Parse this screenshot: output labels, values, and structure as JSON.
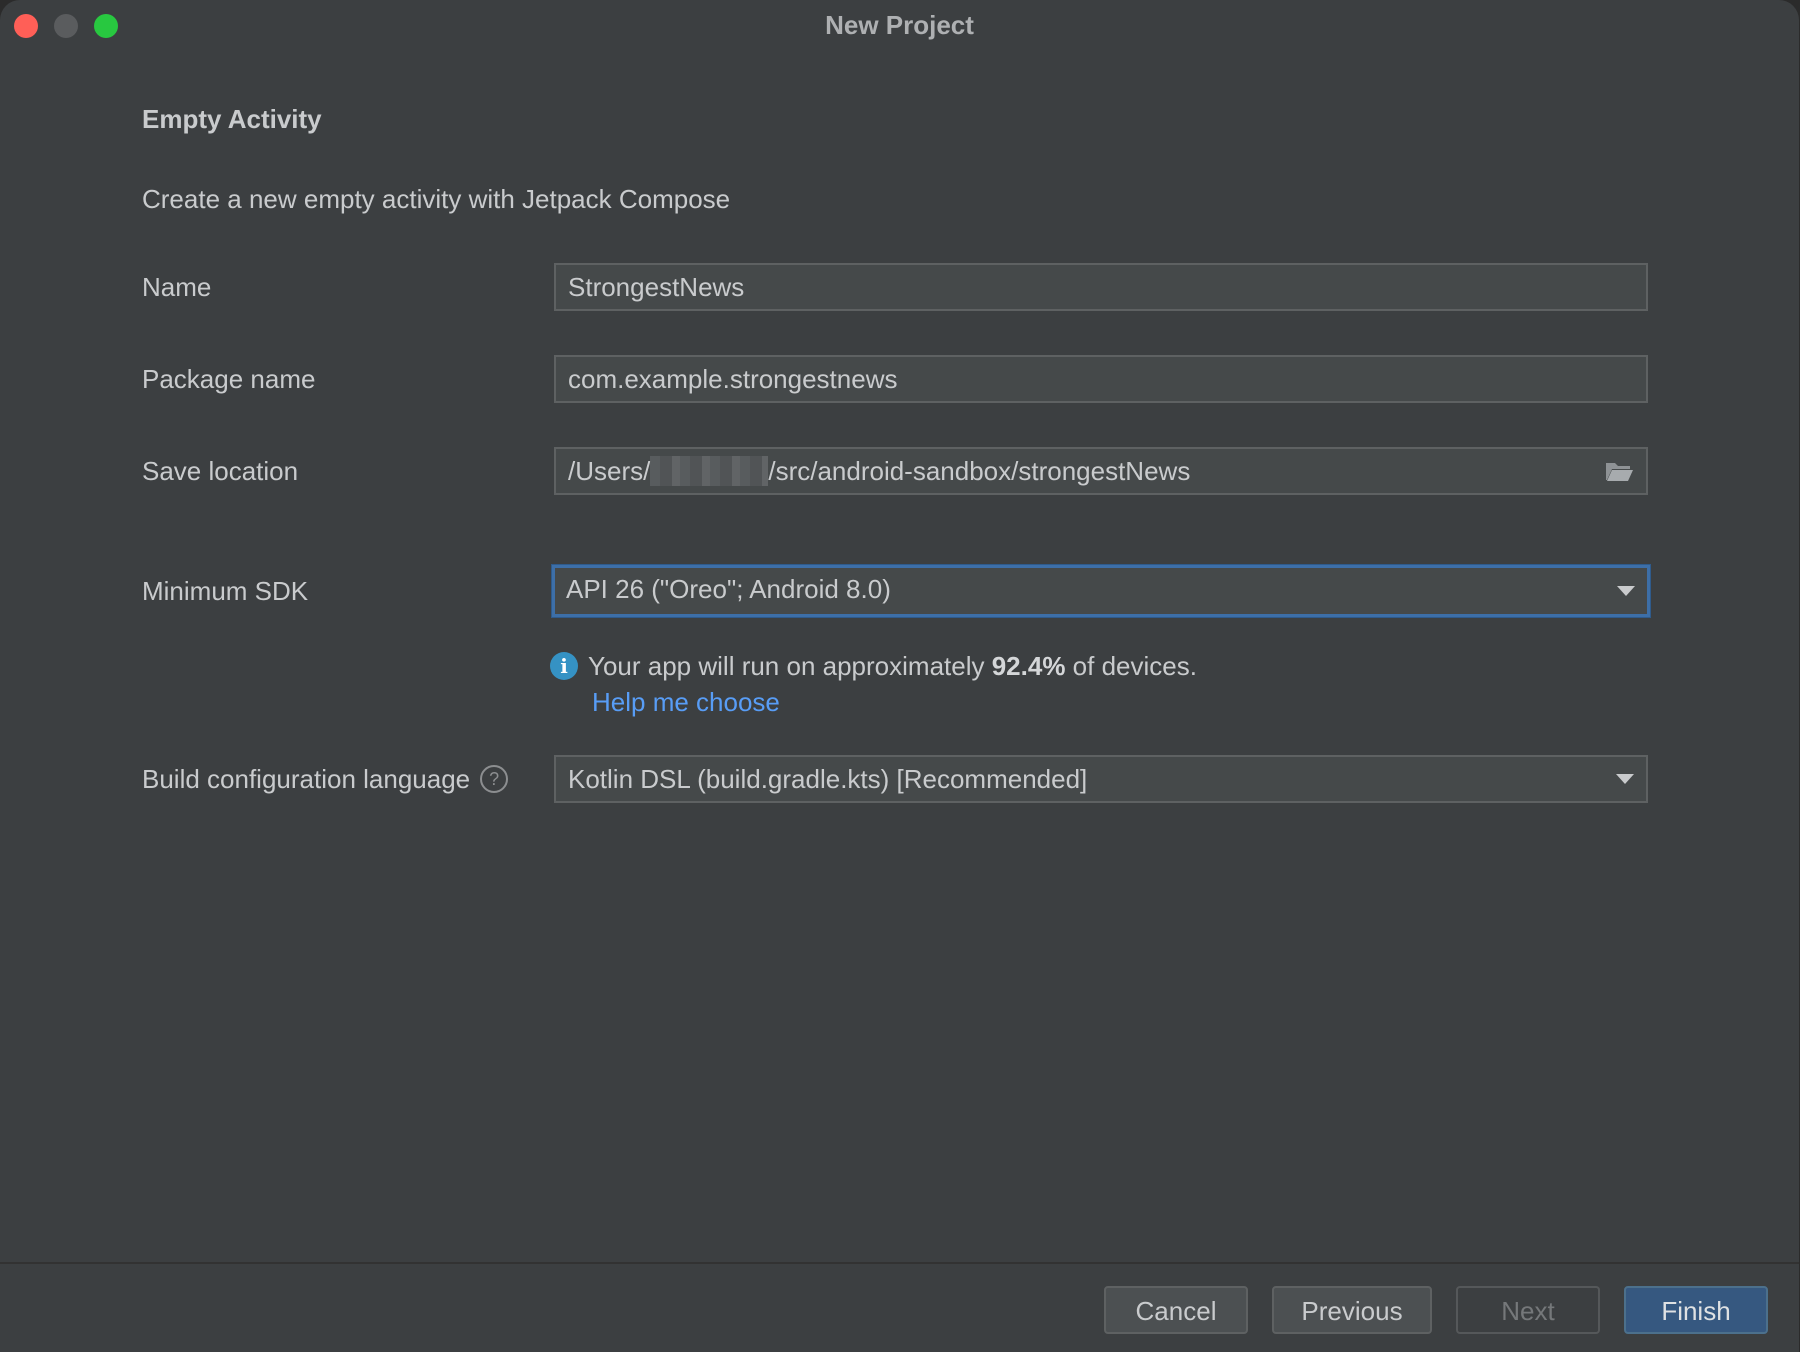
{
  "window": {
    "title": "New Project"
  },
  "template": {
    "heading": "Empty Activity",
    "description": "Create a new empty activity with Jetpack Compose"
  },
  "form": {
    "name": {
      "label": "Name",
      "value": "StrongestNews"
    },
    "package_name": {
      "label": "Package name",
      "value": "com.example.strongestnews"
    },
    "save_location": {
      "label": "Save location",
      "value_prefix": "/Users/",
      "value_suffix": "/src/android-sandbox/strongestNews",
      "icon": "folder-open-icon"
    },
    "minimum_sdk": {
      "label": "Minimum SDK",
      "value": "API 26 (\"Oreo\"; Android 8.0)",
      "icon": "chevron-down-icon"
    },
    "sdk_info": {
      "text_before": "Your app will run on approximately ",
      "percent": "92.4%",
      "text_after": " of devices.",
      "link": "Help me choose",
      "icon": "info-icon"
    },
    "build_config_language": {
      "label": "Build configuration language",
      "help_glyph": "?",
      "value": "Kotlin DSL (build.gradle.kts) [Recommended]",
      "icon": "chevron-down-icon"
    }
  },
  "buttons": {
    "cancel": "Cancel",
    "previous": "Previous",
    "next": "Next",
    "finish": "Finish"
  },
  "colors": {
    "background": "#3c3f41",
    "field": "#45494a",
    "focus_border": "#3d6fa8",
    "link": "#589df6",
    "info_icon": "#3592c4",
    "finish_button": "#365880",
    "traffic_close": "#ff5f57",
    "traffic_max": "#28c840"
  }
}
